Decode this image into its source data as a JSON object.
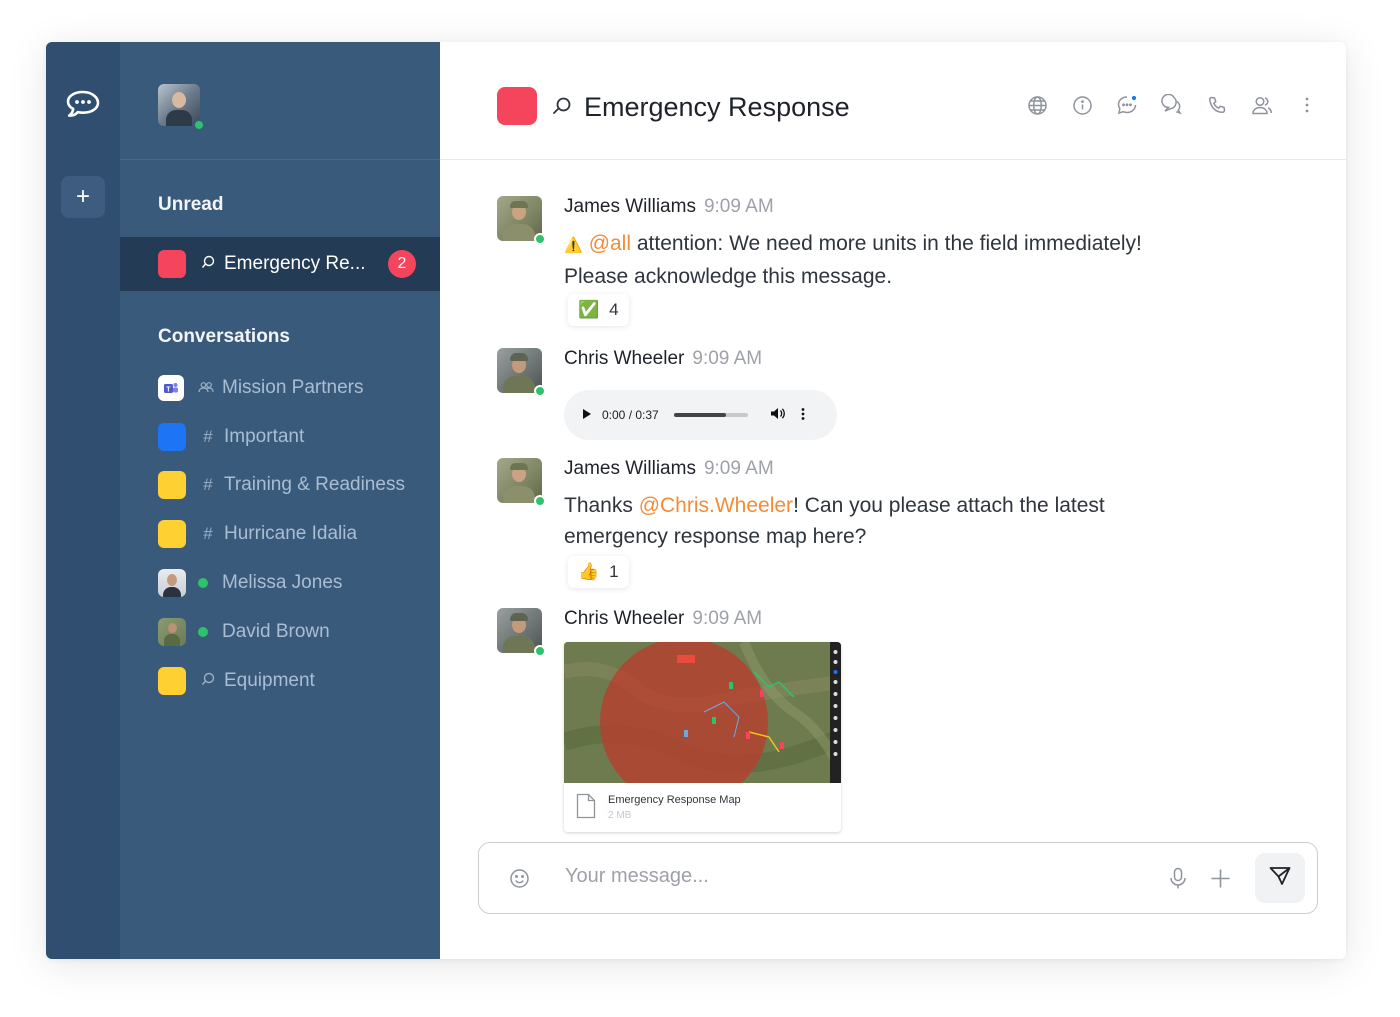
{
  "sidebar": {
    "unread_heading": "Unread",
    "conversations_heading": "Conversations",
    "active_item": {
      "label": "Emergency Re...",
      "badge": "2",
      "color": "#f5455c"
    },
    "items": [
      {
        "label": "Mission Partners",
        "symbol": "team-icon",
        "color": "#ffffff"
      },
      {
        "label": "Important",
        "symbol": "#",
        "color": "#1d74f5"
      },
      {
        "label": "Training & Readiness",
        "symbol": "#",
        "color": "#ffd031"
      },
      {
        "label": "Hurricane Idalia",
        "symbol": "#",
        "color": "#ffd031"
      },
      {
        "label": "Melissa Jones",
        "symbol": "online-dot"
      },
      {
        "label": "David Brown",
        "symbol": "online-dot"
      },
      {
        "label": "Equipment",
        "symbol": "discussion-icon",
        "color": "#ffd031"
      }
    ]
  },
  "header": {
    "title": "Emergency Response",
    "room_color": "#f5455c"
  },
  "messages": [
    {
      "author": "James Williams",
      "time": "9:09 AM",
      "line1_mention": "@all",
      "line1_text": " attention: We need more units in the field immediately!",
      "line2_text": "Please acknowledge this message.",
      "reaction": {
        "emoji": "✅",
        "count": "4"
      }
    },
    {
      "author": "Chris Wheeler",
      "time": "9:09 AM",
      "audio": {
        "time": "0:00 / 0:37",
        "progress": 0.7
      }
    },
    {
      "author": "James Williams",
      "time": "9:09 AM",
      "line1_prefix": "Thanks ",
      "line1_mention": "@Chris.Wheeler",
      "line1_text": "! Can you please attach the latest",
      "line2_text": "emergency response map here?",
      "reaction": {
        "emoji": "👍",
        "count": "1"
      }
    },
    {
      "author": "Chris Wheeler",
      "time": "9:09 AM",
      "attachment": {
        "name": "Emergency Response Map",
        "size": "2 MB"
      }
    }
  ],
  "composer": {
    "placeholder": "Your message..."
  },
  "colors": {
    "rail": "#2f4e70",
    "sidebar": "#3a5a7c",
    "active": "#233b55",
    "mention": "#f38c39",
    "online": "#2dc26b",
    "badge": "#f5455c"
  }
}
